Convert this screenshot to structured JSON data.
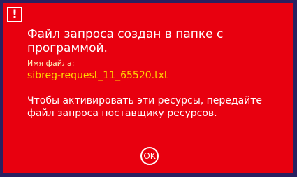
{
  "dialog": {
    "icon": "exclamation-icon",
    "icon_glyph": "!",
    "title": "Файл запроса создан в папке с программой.",
    "filename_label": "Имя файла:",
    "filename": "sibreg-request_11_65520.txt",
    "message": "Чтобы активировать эти ресурсы, передайте файл запроса поставщику ресурсов.",
    "ok_label": "OK"
  },
  "colors": {
    "background": "#e8000f",
    "border": "#2a2060",
    "text": "#ffffff",
    "filename": "#ffd700"
  }
}
